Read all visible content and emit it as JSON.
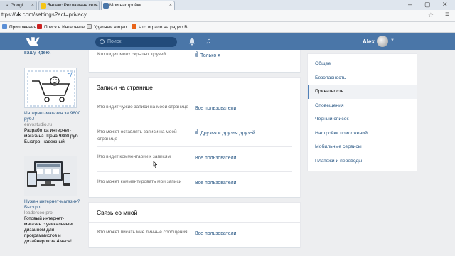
{
  "browser": {
    "tabs": [
      {
        "label": "s: Googl",
        "favicon_color": "#4285f4",
        "active": false
      },
      {
        "label": "Яндекс Рекламная сеть",
        "favicon_color": "#f5c518",
        "active": false
      },
      {
        "label": "Мои настройки",
        "favicon_color": "#4a76a8",
        "active": true
      }
    ],
    "url_scheme": "ttps://",
    "url_host": "vk.com",
    "url_rest": "/settings?act=privacy",
    "bookmarks": [
      {
        "label": "Приложения",
        "icon_color": "#5b8fd6"
      },
      {
        "label": "Поиск в Интернете",
        "icon_color": "#cc2222"
      },
      {
        "label": "Удаляем видео",
        "icon_color": "#888888"
      },
      {
        "label": "Что играло на радио В",
        "icon_color": "#e8641a"
      }
    ],
    "window_controls": [
      "–",
      "▢",
      "✕"
    ]
  },
  "vk_header": {
    "search_placeholder": "Поиск",
    "user_name": "Alex",
    "brand_color": "#4a76a8"
  },
  "ads": {
    "top_cut_text": "вашу идею.",
    "ad1": {
      "title": "Интернет-магазин за 9800 руб.!",
      "site": "envostudio.ru",
      "desc": "Разработка интернет-магазина. Цена 9800 руб. Быстро, надежный!"
    },
    "ad2": {
      "title": "Нужен интернет-магазин? Быстро!",
      "site": "leaderseo.pro",
      "desc": "Готовый интернет-магазин с уникальным дизайном для программистов и дизайнеров за 4 часа!"
    }
  },
  "privacy": {
    "top_row": {
      "label": "Кто видит моих скрытых друзей",
      "value": "Только я",
      "locked": true
    },
    "wall_section": {
      "title": "Записи на странице",
      "rows": [
        {
          "label": "Кто видит чужие записи на моей странице",
          "value": "Все пользователи",
          "locked": false
        },
        {
          "label": "Кто может оставлять записи на моей странице",
          "value": "Друзья и друзья друзей",
          "locked": true
        },
        {
          "label": "Кто видит комментарии к записям",
          "value": "Все пользователи",
          "locked": false
        },
        {
          "label": "Кто может комментировать мои записи",
          "value": "Все пользователи",
          "locked": false
        }
      ]
    },
    "contact_section": {
      "title": "Связь со мной",
      "rows": [
        {
          "label": "Кто может писать мне личные сообщения",
          "value": "Все пользователи",
          "locked": false
        }
      ]
    }
  },
  "settings_menu": [
    {
      "label": "Общее",
      "active": false
    },
    {
      "label": "Безопасность",
      "active": false
    },
    {
      "label": "Приватность",
      "active": true
    },
    {
      "label": "Оповещения",
      "active": false
    },
    {
      "label": "Чёрный список",
      "active": false
    },
    {
      "label": "Настройки приложений",
      "active": false
    },
    {
      "label": "Мобильные сервисы",
      "active": false
    },
    {
      "label": "Платежи и переводы",
      "active": false
    }
  ]
}
